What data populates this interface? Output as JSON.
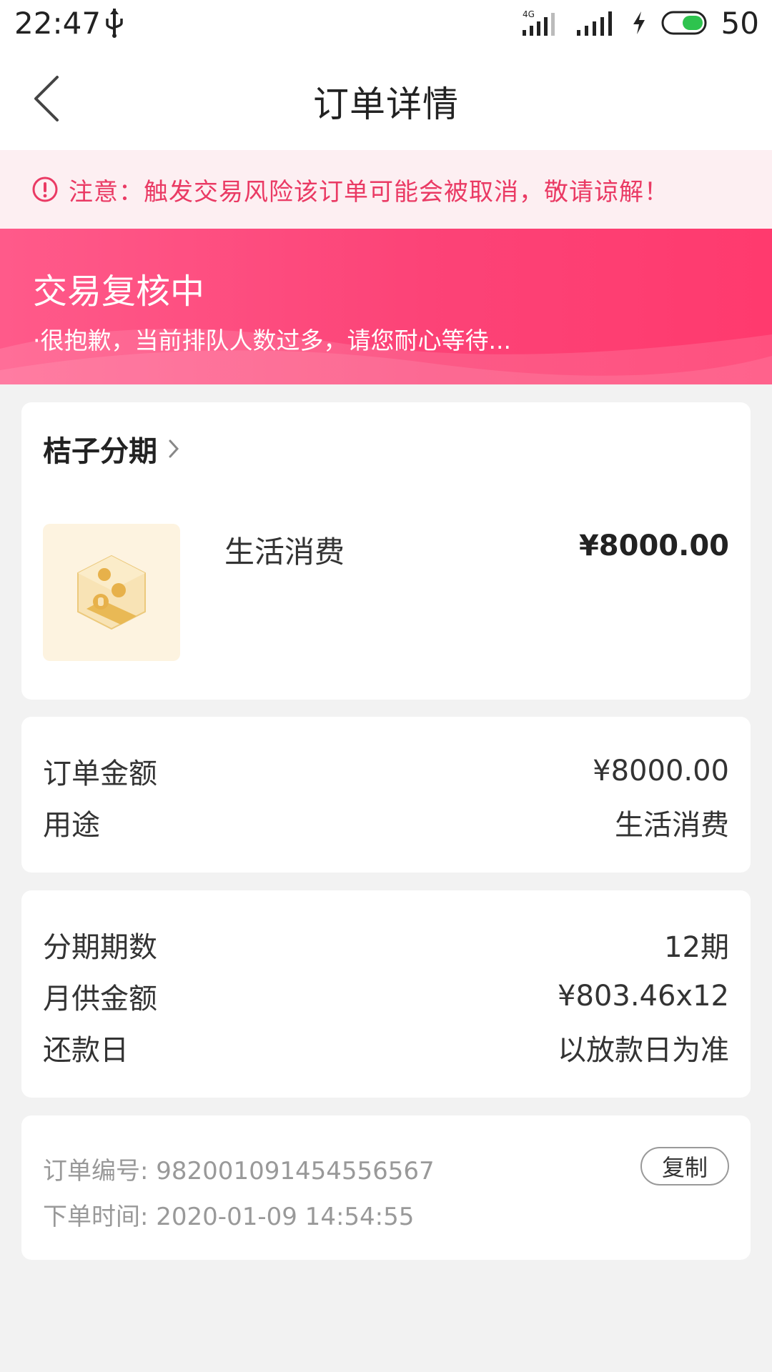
{
  "status_bar": {
    "time": "22:47",
    "network": "4G",
    "battery": "50",
    "icons": [
      "usb-icon",
      "signal-4g-icon",
      "signal-icon",
      "charging-icon",
      "battery-toggle-icon"
    ]
  },
  "header": {
    "title": "订单详情",
    "back_icon": "chevron-left-icon"
  },
  "warning": {
    "text": "注意：触发交易风险该订单可能会被取消，敬请谅解！",
    "color": "#ea3a64",
    "icon": "exclamation-circle-icon"
  },
  "status": {
    "title": "交易复核中",
    "subtitle": "·很抱歉，当前排队人数过多，请您耐心等待...",
    "color": "#fc4377"
  },
  "product": {
    "merchant": "桔子分期",
    "name": "生活消费",
    "price": "¥8000.00",
    "image_icon": "coin-box-icon"
  },
  "order_info": {
    "amount_label": "订单金额",
    "amount_value": "¥8000.00",
    "purpose_label": "用途",
    "purpose_value": "生活消费"
  },
  "installment": {
    "periods_label": "分期期数",
    "periods_value": "12期",
    "monthly_label": "月供金额",
    "monthly_value": "¥803.46x12",
    "repay_label": "还款日",
    "repay_value": "以放款日为准"
  },
  "meta": {
    "order_no_label": "订单编号:",
    "order_no": "982001091454556567",
    "time_label": "下单时间:",
    "time": "2020-01-09 14:54:55",
    "copy_label": "复制"
  }
}
